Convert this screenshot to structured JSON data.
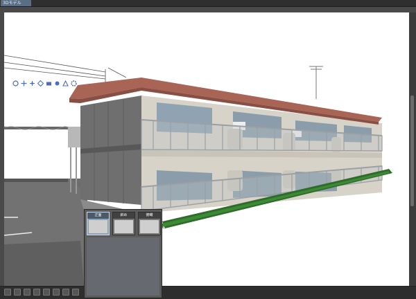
{
  "window": {
    "tab_label": "3Dモデル"
  },
  "toolbar": {
    "icons": [
      "rotate-icon",
      "move-icon",
      "pan-icon",
      "zoom-icon",
      "camera-icon",
      "light-icon",
      "perspective-icon",
      "settings-icon"
    ]
  },
  "presets": [
    {
      "label": "正面",
      "selected": true
    },
    {
      "label": "斜め",
      "selected": false
    },
    {
      "label": "俯瞰",
      "selected": false
    }
  ],
  "colors": {
    "roof": "#a86455",
    "wall": "#d8d3c8",
    "side_wall": "#6f6f6f",
    "hedge": "#2f6b2a",
    "asphalt": "#6a6a6a",
    "accent": "#4a6ec0"
  }
}
